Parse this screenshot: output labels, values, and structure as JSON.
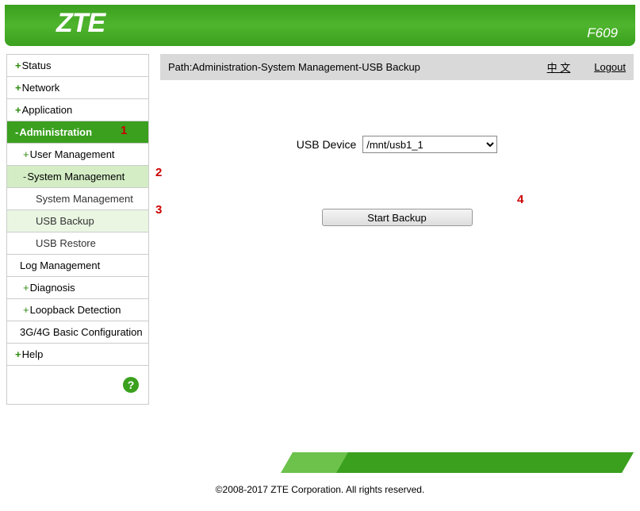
{
  "header": {
    "brand": "ZTE",
    "model": "F609"
  },
  "pathbar": {
    "path": "Path:Administration-System Management-USB Backup",
    "lang": "中 文",
    "logout": "Logout"
  },
  "sidebar": {
    "status": "Status",
    "network": "Network",
    "application": "Application",
    "administration": "Administration",
    "user_mgmt": "User Management",
    "sys_mgmt": "System Management",
    "sys_mgmt_sub": "System Management",
    "usb_backup": "USB Backup",
    "usb_restore": "USB Restore",
    "log_mgmt": "Log Management",
    "diagnosis": "Diagnosis",
    "loopback": "Loopback Detection",
    "config_3g4g": "3G/4G Basic Configuration",
    "help": "Help"
  },
  "form": {
    "usb_device_label": "USB Device",
    "usb_device_value": "/mnt/usb1_1",
    "start_backup": "Start Backup"
  },
  "annotations": {
    "a1": "1",
    "a2": "2",
    "a3": "3",
    "a4": "4"
  },
  "footer": {
    "copyright": "©2008-2017 ZTE Corporation. All rights reserved."
  }
}
